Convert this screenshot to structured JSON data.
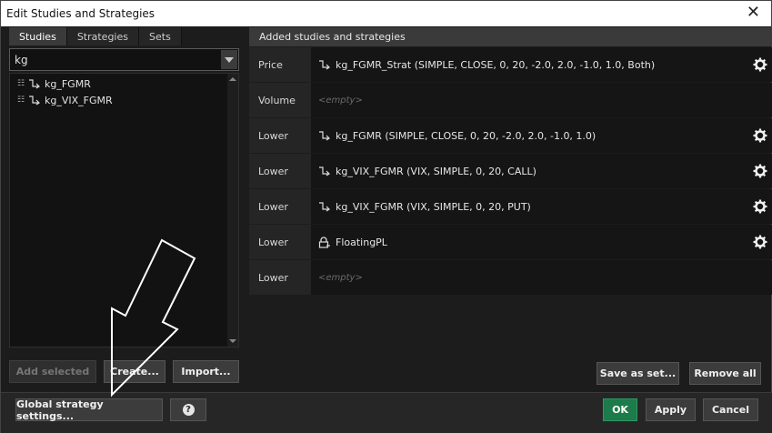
{
  "window": {
    "title": "Edit Studies and Strategies",
    "close_glyph": "✕"
  },
  "left": {
    "tabs": [
      {
        "label": "Studies",
        "active": true
      },
      {
        "label": "Strategies",
        "active": false
      },
      {
        "label": "Sets",
        "active": false
      }
    ],
    "search": {
      "value": "kg"
    },
    "tree_items": [
      {
        "label": "kg_FGMR",
        "icon": "strategy-icon"
      },
      {
        "label": "kg_VIX_FGMR",
        "icon": "strategy-icon"
      }
    ],
    "buttons": {
      "add_selected": "Add selected",
      "create": "Create...",
      "import": "Import..."
    }
  },
  "right": {
    "header": "Added studies and strategies",
    "rows": [
      {
        "label": "Price",
        "value": "kg_FGMR_Strat (SIMPLE, CLOSE, 0, 20, -2.0, 2.0, -1.0, 1.0, Both)",
        "icon": "strategy-icon",
        "empty": false
      },
      {
        "label": "Volume",
        "value": "<empty>",
        "icon": "",
        "empty": true
      },
      {
        "label": "Lower",
        "value": "kg_FGMR (SIMPLE, CLOSE, 0, 20, -2.0, 2.0, -1.0, 1.0)",
        "icon": "strategy-icon",
        "empty": false
      },
      {
        "label": "Lower",
        "value": "kg_VIX_FGMR (VIX, SIMPLE, 0, 20, CALL)",
        "icon": "strategy-icon",
        "empty": false
      },
      {
        "label": "Lower",
        "value": "kg_VIX_FGMR (VIX, SIMPLE, 0, 20, PUT)",
        "icon": "strategy-icon",
        "empty": false
      },
      {
        "label": "Lower",
        "value": "FloatingPL",
        "icon": "lock-icon",
        "empty": false
      },
      {
        "label": "Lower",
        "value": "<empty>",
        "icon": "",
        "empty": true
      }
    ],
    "buttons": {
      "save_as_set": "Save as set...",
      "remove_all": "Remove all"
    }
  },
  "bottom": {
    "global_settings": "Global strategy settings...",
    "help": "?",
    "ok": "OK",
    "apply": "Apply",
    "cancel": "Cancel"
  },
  "colors": {
    "ok_button": "#1d7a4a",
    "titlebar": "#ffffff",
    "panel": "#1c1c1c"
  }
}
